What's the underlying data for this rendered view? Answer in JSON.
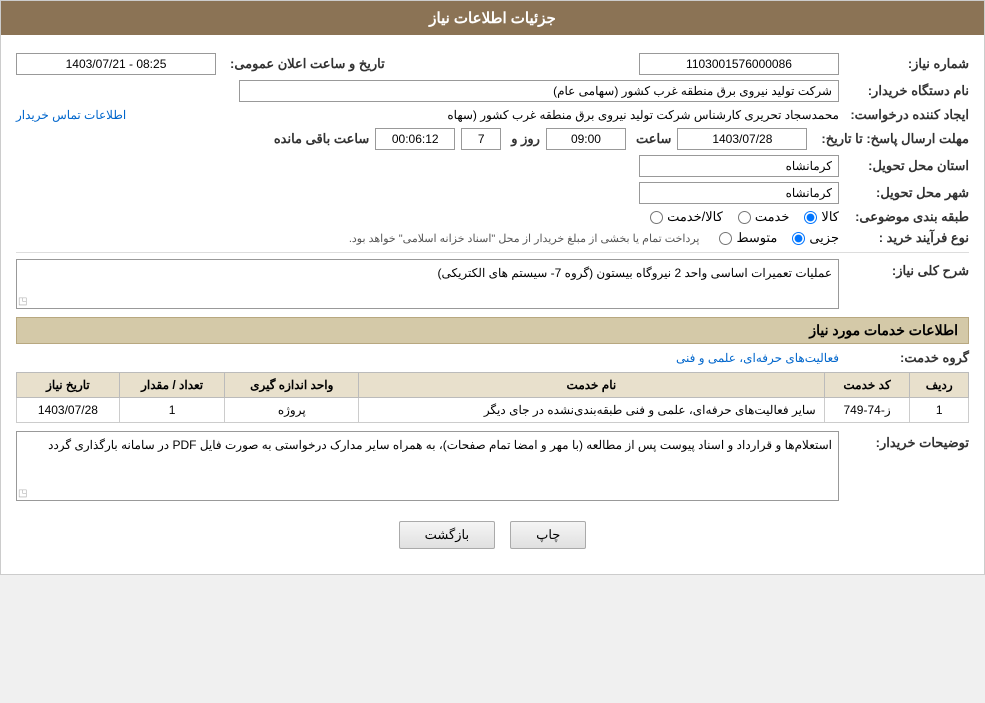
{
  "header": {
    "title": "جزئیات اطلاعات نیاز"
  },
  "fields": {
    "shomara_niaz_label": "شماره نیاز:",
    "shomara_niaz_value": "1103001576000086",
    "nam_dastgah_label": "نام دستگاه خریدار:",
    "nam_dastgah_value": "شرکت تولید نیروی برق منطقه غرب کشور (سهامی عام)",
    "eijad_label": "ایجاد کننده درخواست:",
    "eijad_value": "محمدسجاد تحریری کارشناس شرکت تولید نیروی برق منطقه غرب کشور (سهاه",
    "eijad_link": "اطلاعات تماس خریدار",
    "mohlat_label": "مهلت ارسال پاسخ: تا تاریخ:",
    "mohlat_date": "1403/07/28",
    "mohlat_time_label": "ساعت",
    "mohlat_time": "09:00",
    "mohlat_rooz_label": "روز و",
    "mohlat_rooz": "7",
    "mohlat_mande_label": "ساعت باقی مانده",
    "mohlat_mande": "00:06:12",
    "ostan_label": "استان محل تحویل:",
    "ostan_value": "کرمانشاه",
    "shahr_label": "شهر محل تحویل:",
    "shahr_value": "کرمانشاه",
    "tabaqe_label": "طبقه بندی موضوعی:",
    "tabaqe_options": [
      "کالا",
      "خدمت",
      "کالا/خدمت"
    ],
    "tabaqe_selected": "کالا",
    "nooe_farayand_label": "نوع فرآیند خرید :",
    "nooe_farayand_options": [
      "جزیی",
      "متوسط"
    ],
    "nooe_farayand_note": "پرداخت تمام یا بخشی از مبلغ خریدار از محل \"اسناد خزانه اسلامی\" خواهد بود.",
    "tarikh_label": "تاریخ و ساعت اعلان عمومی:",
    "tarikh_value": "1403/07/21 - 08:25",
    "sharh_niaz_label": "شرح کلی نیاز:",
    "sharh_niaz_value": "عملیات تعمیرات اساسی واحد 2 نیروگاه بیستون (گروه 7- سیستم های الکتریکی)",
    "khadamat_label": "اطلاعات خدمات مورد نیاز",
    "gorooh_khadamat_label": "گروه خدمت:",
    "gorooh_khadamat_value": "فعالیت‌های حرفه‌ای، علمی و فنی",
    "table_headers": [
      "ردیف",
      "کد خدمت",
      "نام خدمت",
      "واحد اندازه گیری",
      "تعداد / مقدار",
      "تاریخ نیاز"
    ],
    "table_rows": [
      {
        "radif": "1",
        "kod": "ز-74-749",
        "name": "سایر فعالیت‌های حرفه‌ای، علمی و فنی طبقه‌بندی‌نشده در جای دیگر",
        "vahed": "پروژه",
        "tedad": "1",
        "tarikh": "1403/07/28"
      }
    ],
    "tawzihat_label": "توضیحات خریدار:",
    "tawzihat_value": "استعلام‌ها و قرارداد و اسناد پیوست پس از مطالعه (با مهر و امضا تمام صفحات)، به همراه سایر مدارک درخواستی به صورت فایل PDF در سامانه بارگذاری گردد"
  },
  "buttons": {
    "print": "چاپ",
    "back": "بازگشت"
  }
}
